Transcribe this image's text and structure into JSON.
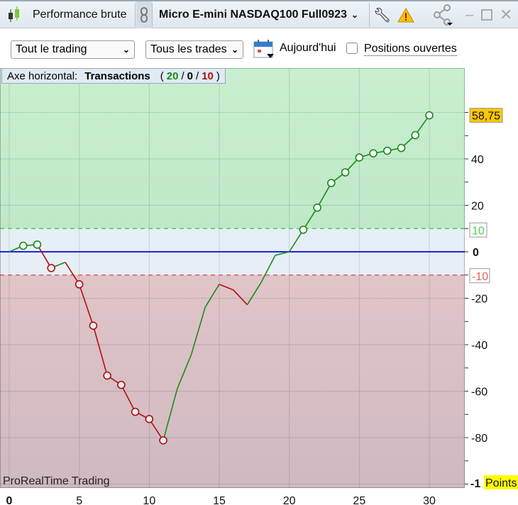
{
  "topbar": {
    "title": "Performance brute",
    "instrument": "Micro E-mini NASDAQ100 Full0923",
    "icons": [
      "candlestick-icon",
      "link-icon",
      "wrench-icon",
      "warning-icon",
      "share-icon",
      "minimize-icon",
      "maximize-icon",
      "close-icon"
    ]
  },
  "controls": {
    "scope": "Tout le trading",
    "trades": "Tous les trades",
    "date_label": "Aujourd'hui",
    "open_positions": "Positions ouvertes",
    "open_positions_checked": false
  },
  "axis_info": {
    "label": "Axe horizontal:",
    "mode": "Transactions",
    "open": "(",
    "wins": "20",
    "sep1": "/",
    "neutral": "0",
    "sep2": "/",
    "losses": "10",
    "close": ")"
  },
  "brand": "ProRealTime Trading",
  "colors": {
    "up": "#1a8a1a",
    "down": "#b01010",
    "zero": "#2020e0",
    "green_zone": "#c8f0d0",
    "red_zone": "#d4bcc4",
    "neutral_zone": "#e6eff5",
    "current_badge": "#ffc800"
  },
  "chart_data": {
    "type": "line",
    "title": "Performance brute",
    "xlabel": "Transactions",
    "ylabel": "Points",
    "xlim": [
      -0.6,
      32.6
    ],
    "ylim": [
      -101.7,
      79
    ],
    "x_ticks": [
      0,
      5,
      10,
      15,
      20,
      25,
      30
    ],
    "y_ticks": [
      40,
      20,
      0,
      -20,
      -40,
      -60,
      -80
    ],
    "y_unit_label": "Points",
    "bottom_clipped_label": "-1",
    "current_value_label": "58,75",
    "thresholds": {
      "upper": 10,
      "lower": -10,
      "upper_label": "10",
      "lower_label": "-10"
    },
    "x": [
      0,
      1,
      2,
      3,
      4,
      5,
      6,
      7,
      8,
      9,
      10,
      11,
      12,
      13,
      14,
      15,
      16,
      17,
      18,
      19,
      20,
      21,
      22,
      23,
      24,
      25,
      26,
      27,
      28,
      29,
      30
    ],
    "values": [
      0,
      2.6,
      3.1,
      -7,
      -4.5,
      -14,
      -31.8,
      -53.3,
      -57.3,
      -68.9,
      -72,
      -81.2,
      -59,
      -44.3,
      -23.8,
      -14,
      -16.4,
      -22.8,
      -13.1,
      -1.5,
      0,
      9.5,
      19,
      29.6,
      34.2,
      40.6,
      42.4,
      43.5,
      44.7,
      50.2,
      58.75
    ],
    "markers": [
      1,
      2,
      3,
      5,
      6,
      7,
      8,
      9,
      10,
      11,
      21,
      22,
      23,
      24,
      25,
      26,
      27,
      28,
      29,
      30
    ]
  }
}
